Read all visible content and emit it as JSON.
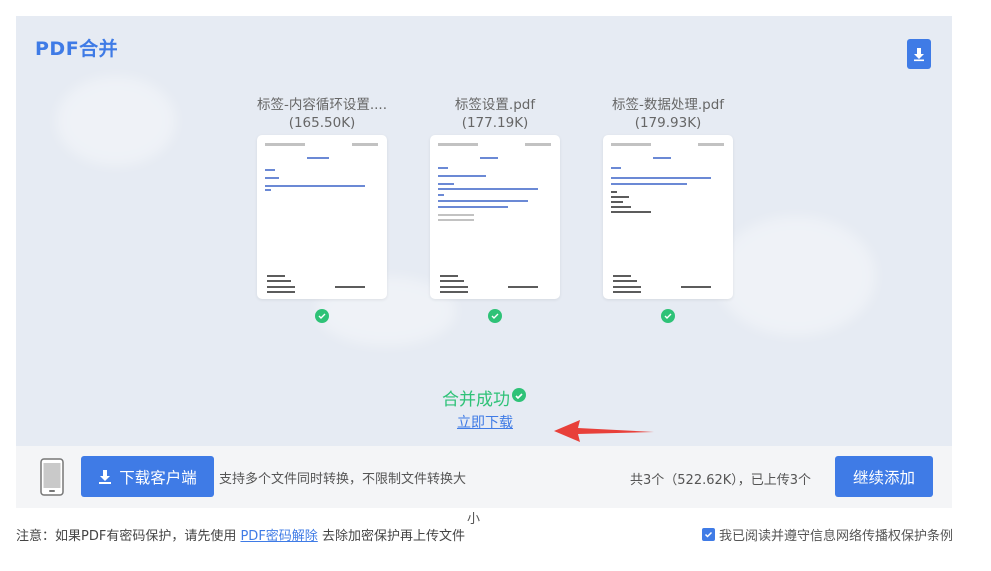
{
  "header": {
    "title": "PDF合并"
  },
  "files": [
    {
      "name": "标签-内容循环设置....",
      "size": "(165.50K)"
    },
    {
      "name": "标签设置.pdf",
      "size": "(177.19K)"
    },
    {
      "name": "标签-数据处理.pdf",
      "size": "(179.93K)"
    }
  ],
  "result": {
    "success_text": "合并成功",
    "download_link": "立即下载"
  },
  "footer": {
    "client_button": "下载客户端",
    "support_text": "支持多个文件同时转换，不限制文件转换大",
    "support_tail": "小",
    "total_text": "共3个（522.62K），已上传3个",
    "add_button": "继续添加"
  },
  "notice": {
    "prefix": "注意：如果PDF有密码保护，请先使用",
    "link": "PDF密码解除",
    "suffix": "去除加密保护再上传文件"
  },
  "agreement": {
    "label": "我已阅读并遵守信息网络传播权保护条例",
    "checked": true
  },
  "colors": {
    "accent": "#3f7be6",
    "success": "#2ec277",
    "arrow": "#e8403a",
    "panel": "#e6ebf3"
  }
}
